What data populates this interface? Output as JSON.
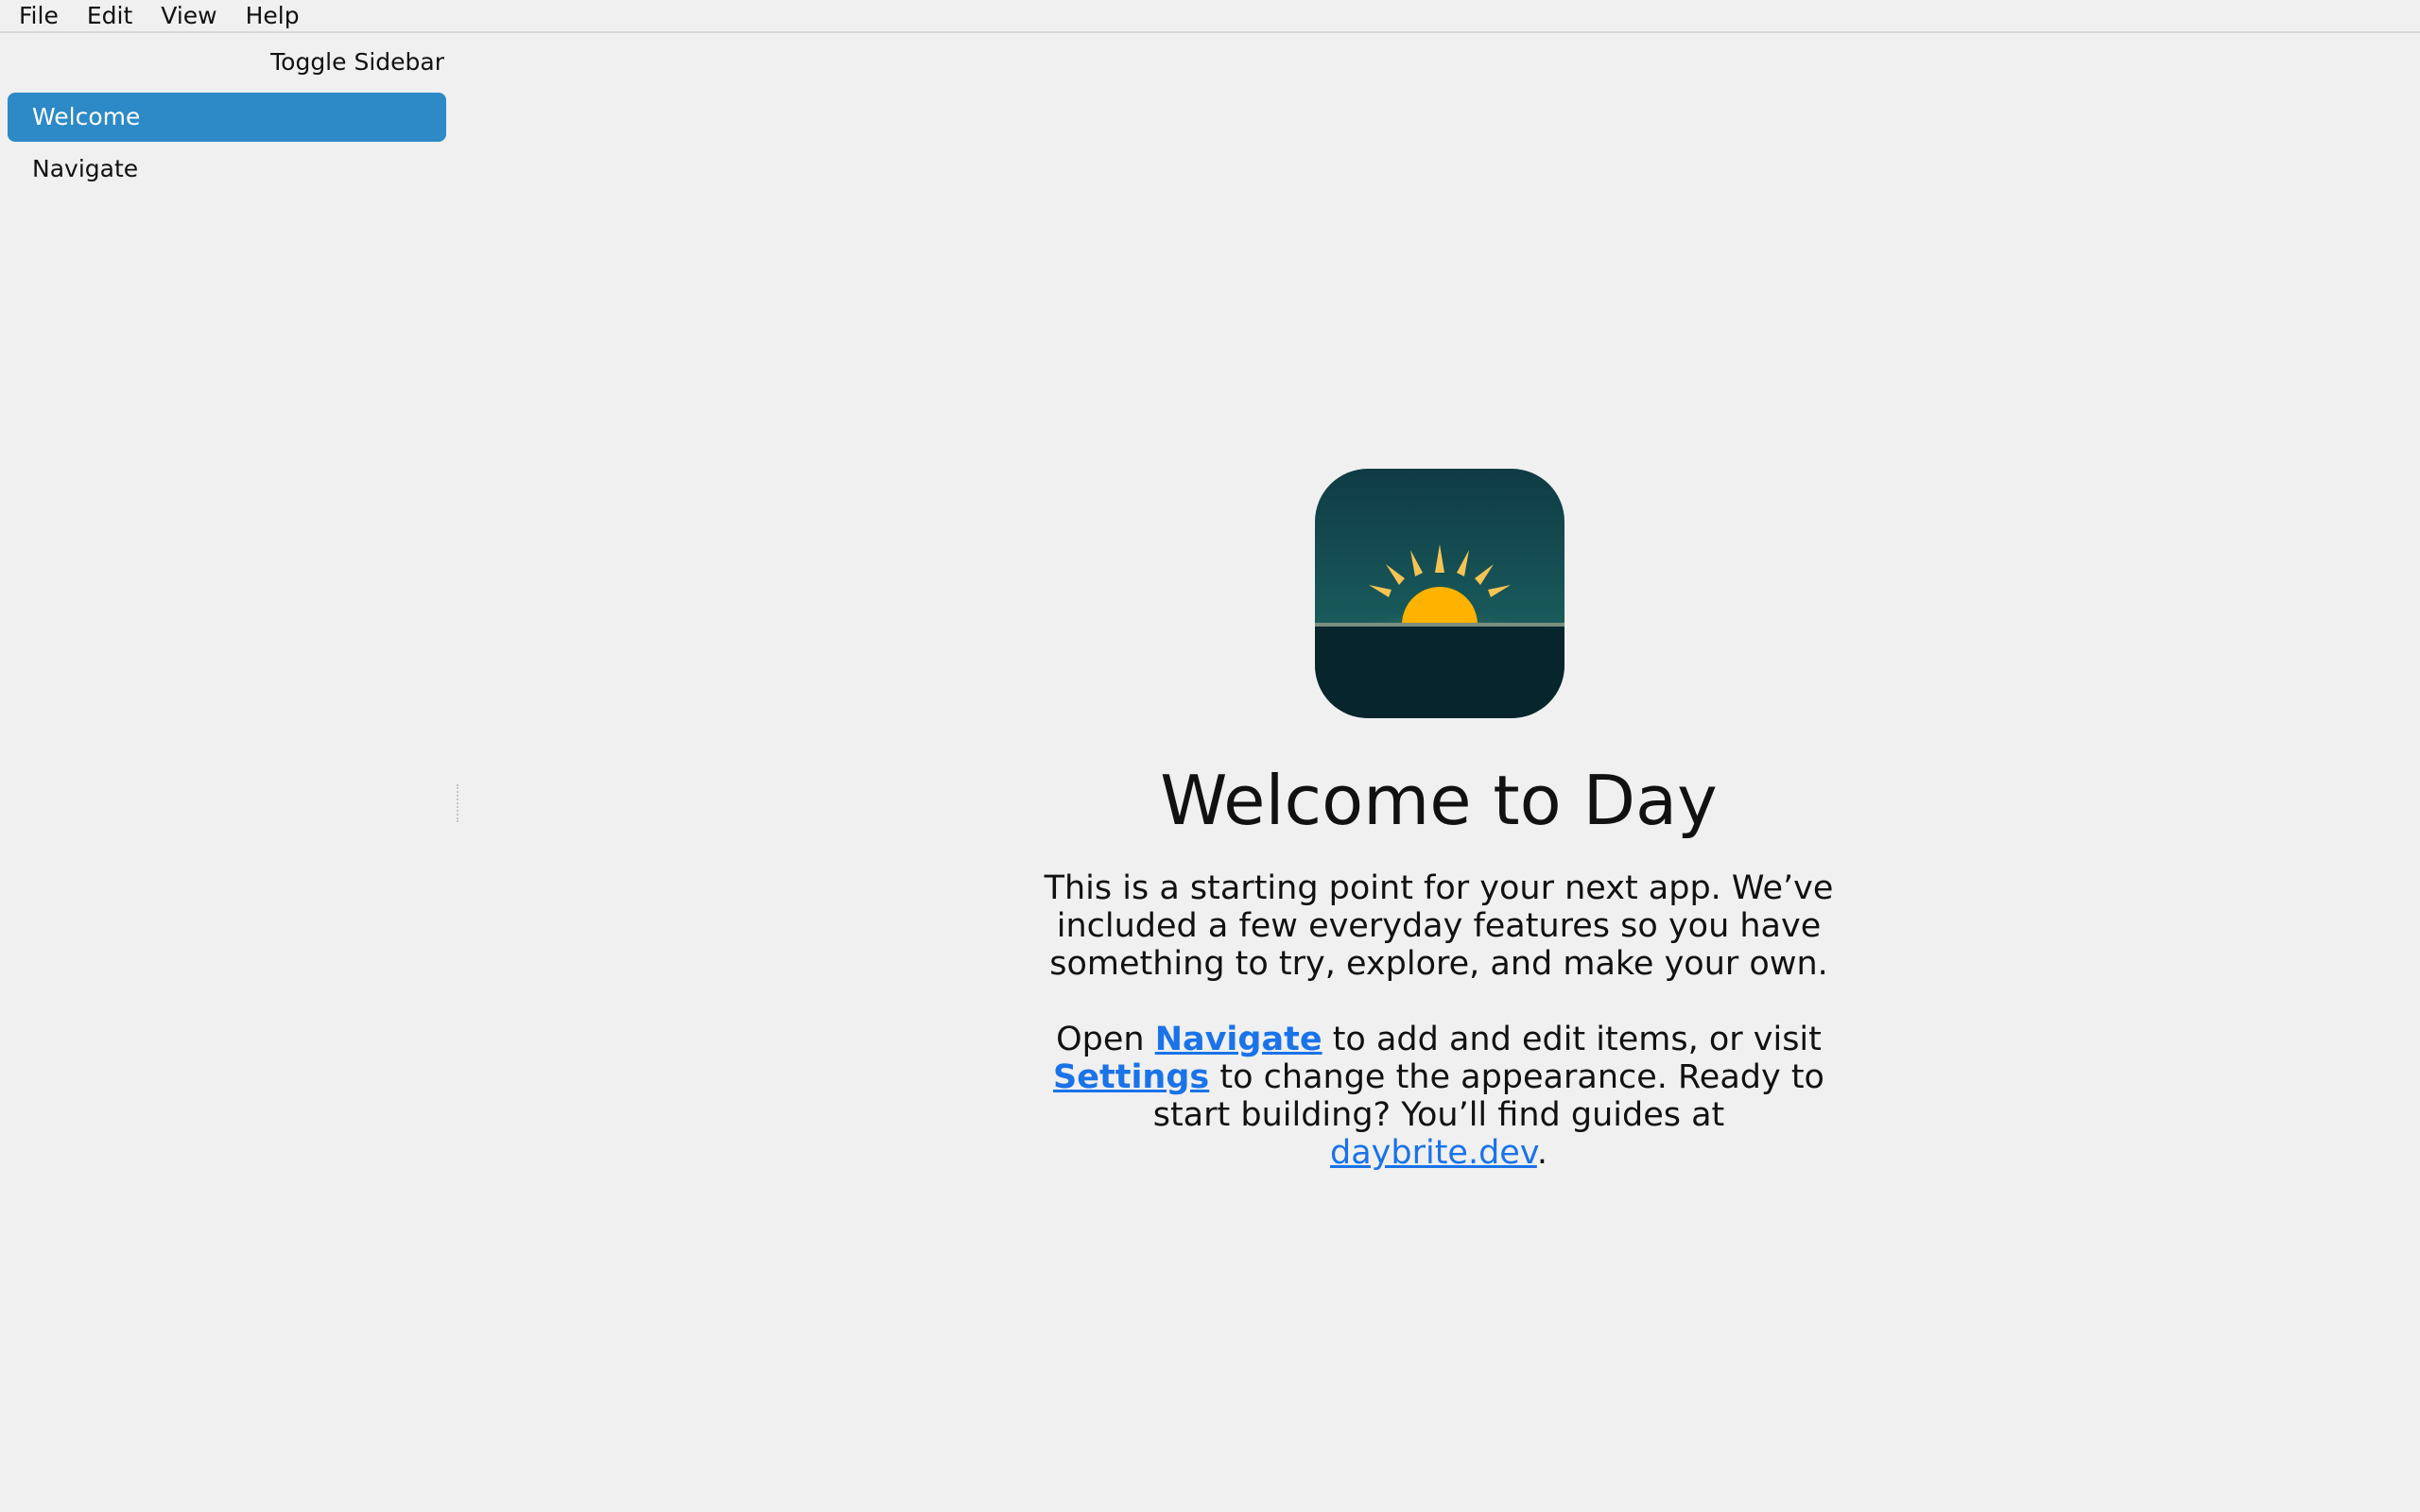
{
  "menubar": {
    "items": [
      "File",
      "Edit",
      "View",
      "Help"
    ]
  },
  "sidebar": {
    "toggle_label": "Toggle Sidebar",
    "items": [
      {
        "label": "Welcome",
        "active": true
      },
      {
        "label": "Navigate",
        "active": false
      }
    ]
  },
  "main": {
    "logo_icon": "sunrise-app-icon",
    "title": "Welcome to Day",
    "intro": "This is a starting point for your next app. We’ve included a few everyday features so you have something to try, explore, and make your own.",
    "para2": {
      "open_text": "Open ",
      "navigate_link": "Navigate",
      "mid_text": " to add and edit items, or visit ",
      "settings_link": "Settings",
      "after_settings": " to change the appearance. Ready to start building? You’ll find guides at ",
      "site_link": "daybrite.dev",
      "end_text": "."
    }
  },
  "colors": {
    "accent": "#2d8ac7",
    "link": "#1a73e8",
    "background": "#f0f0f0"
  }
}
